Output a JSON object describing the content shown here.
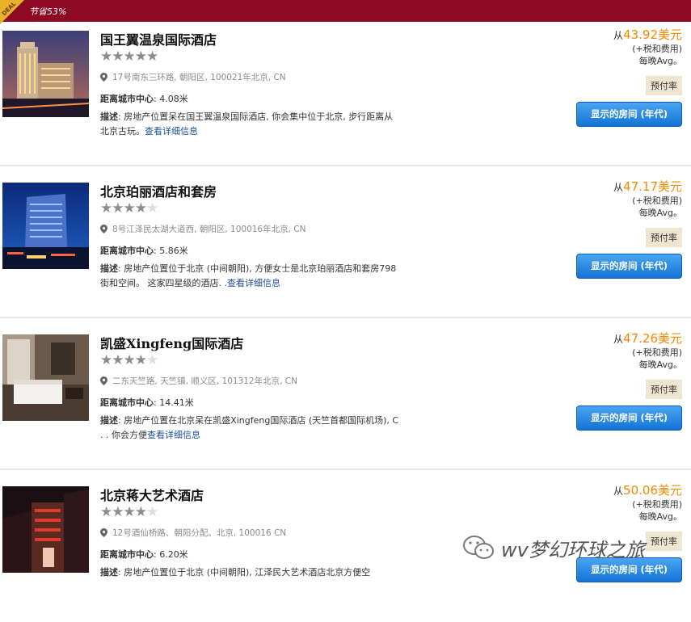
{
  "deal_bar": {
    "badge": "DEAL",
    "text": "节省53%"
  },
  "hotels": [
    {
      "name": "国王翼温泉国际酒店",
      "rating": 5,
      "address": "17号南东三环路, 朝阳区, 100021年北京, CN",
      "distance_label": "距离城市中心",
      "distance_value": ": 4.08米",
      "desc_label": "描述",
      "desc_text": ": 房地产位置呆在国王翼温泉国际酒店, 你会集中位于北京, 步行距离从北京古玩。",
      "more_link": "查看详细信息",
      "price_from": "从",
      "price_amount": "43.92美元",
      "price_tax": "(+税和费用)",
      "price_avg": "每晚Avg。",
      "prepay": "预付率",
      "button": "显示的房间 (年代)"
    },
    {
      "name": "北京珀丽酒店和套房",
      "rating": 4,
      "address": "8号江泽民太湖大道西, 朝阳区, 100016年北京, CN",
      "distance_label": "距离城市中心",
      "distance_value": ": 5.86米",
      "desc_label": "描述",
      "desc_text": ": 房地产位置位于北京 (中间朝阳), 方便女士是北京珀丽酒店和套房798街和空间。 这家四星级的酒店. .",
      "more_link": "查看详细信息",
      "price_from": "从",
      "price_amount": "47.17美元",
      "price_tax": "(+税和费用)",
      "price_avg": "每晚Avg。",
      "prepay": "预付率",
      "button": "显示的房间 (年代)"
    },
    {
      "name": "凯盛Xingfeng国际酒店",
      "rating": 4,
      "address": "二东天竺路, 天竺镇, 顺义区, 101312年北京, CN",
      "distance_label": "距离城市中心",
      "distance_value": ": 14.41米",
      "desc_label": "描述",
      "desc_text": ": 房地产位置在北京呆在凯盛Xingfeng国际酒店 (天竺首都国际机场), C . . 你会方便",
      "more_link": "查看详细信息",
      "price_from": "从",
      "price_amount": "47.26美元",
      "price_tax": "(+税和费用)",
      "price_avg": "每晚Avg。",
      "prepay": "预付率",
      "button": "显示的房间 (年代)"
    },
    {
      "name": "北京蒋大艺术酒店",
      "rating": 4,
      "address": "12号酒仙桥路、朝阳分配。北京, 100016 CN",
      "distance_label": "距离城市中心",
      "distance_value": ": 6.20米",
      "desc_label": "描述",
      "desc_text": ": 房地产位置位于北京 (中间朝阳), 江泽民大艺术酒店北京方便空",
      "more_link": "",
      "price_from": "从",
      "price_amount": "50.06美元",
      "price_tax": "(+税和费用)",
      "price_avg": "每晚Avg。",
      "prepay": "预付率",
      "button": "显示的房间 (年代)"
    }
  ],
  "watermark": {
    "text": "wv梦幻环球之旅"
  },
  "colors": {
    "deal_bar": "#8e0a22",
    "price": "#f08a00",
    "button": "#1473d6",
    "link": "#1a4f9c"
  }
}
